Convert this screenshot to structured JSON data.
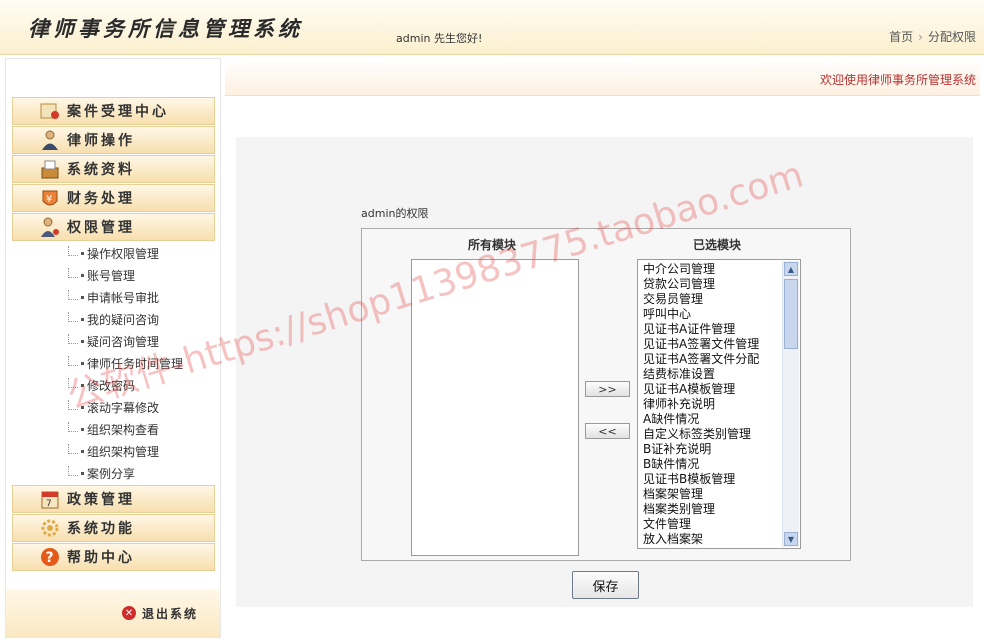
{
  "header": {
    "title": "律师事务所信息管理系统",
    "welcome": "admin 先生您好!",
    "breadcrumb": [
      "首页",
      "分配权限"
    ]
  },
  "sidebar": {
    "menus_top": [
      {
        "label": "案件受理中心",
        "icon": "case-icon"
      },
      {
        "label": "律师操作",
        "icon": "lawyer-icon"
      },
      {
        "label": "系统资料",
        "icon": "archive-icon"
      },
      {
        "label": "财务处理",
        "icon": "finance-icon"
      },
      {
        "label": "权限管理",
        "icon": "permission-icon"
      }
    ],
    "sub_items": [
      "操作权限管理",
      "账号管理",
      "申请帐号审批",
      "我的疑问咨询",
      "疑问咨询管理",
      "律师任务时间管理",
      "修改密码",
      "滚动字幕修改",
      "组织架构查看",
      "组织架构管理",
      "案例分享"
    ],
    "menus_bottom": [
      {
        "label": "政策管理",
        "icon": "calendar-icon"
      },
      {
        "label": "系统功能",
        "icon": "gear-icon"
      },
      {
        "label": "帮助中心",
        "icon": "help-icon"
      }
    ],
    "logout": "退出系统"
  },
  "main": {
    "welcome_bar": "欢迎使用律师事务所管理系统",
    "perm_label": "admin的权限",
    "all_modules_header": "所有模块",
    "selected_modules_header": "已选模块",
    "add_button": ">>",
    "remove_button": "<<",
    "save_button": "保存",
    "selected_modules": [
      "中介公司管理",
      "贷款公司管理",
      "交易员管理",
      "呼叫中心",
      "见证书A证件管理",
      "见证书A签署文件管理",
      "见证书A签署文件分配",
      "结费标准设置",
      "见证书A模板管理",
      "律师补充说明",
      "A缺件情况",
      "自定义标签类别管理",
      "B证补充说明",
      "B缺件情况",
      "见证书B模板管理",
      "档案架管理",
      "档案类别管理",
      "文件管理",
      "放入档案架"
    ]
  },
  "watermark": "公软件-https://shop113983775.taobao.com",
  "colors": {
    "accent_red": "#b83232",
    "header_bg": "#fbefcd",
    "menu_bg": "#f7dfae"
  }
}
